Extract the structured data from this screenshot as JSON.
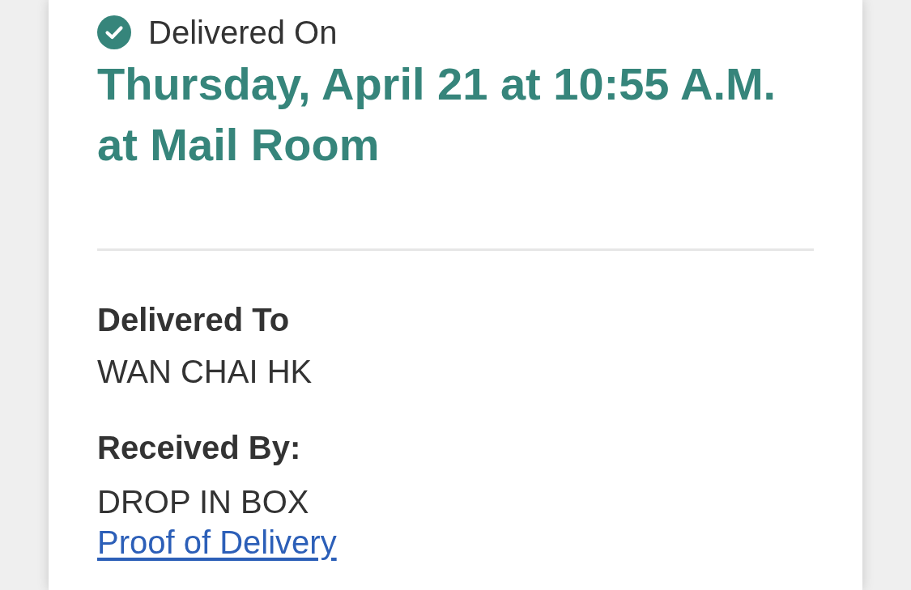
{
  "status": {
    "label": "Delivered On",
    "datetime": "Thursday, April 21 at 10:55 A.M. at Mail Room"
  },
  "details": [
    {
      "label": "Delivered To",
      "value": "WAN CHAI HK"
    },
    {
      "label": "Received By:",
      "value": "DROP IN BOX",
      "link": "Proof of Delivery"
    }
  ]
}
